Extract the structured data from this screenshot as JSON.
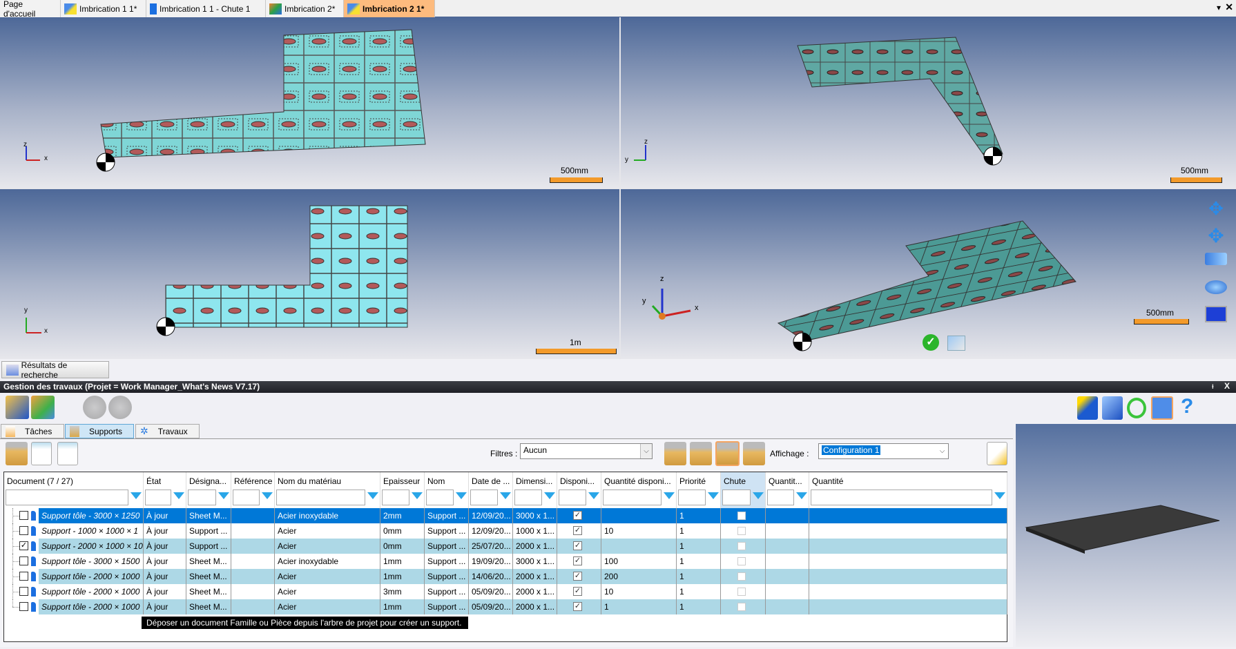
{
  "doc_tabs": [
    {
      "label": "Page d'accueil",
      "icon": "home",
      "active": false
    },
    {
      "label": "Imbrication 1 1*",
      "icon": "nesting-icon",
      "active": false
    },
    {
      "label": "Imbrication 1 1 - Chute 1",
      "icon": "sheet-icon",
      "active": false
    },
    {
      "label": "Imbrication 2*",
      "icon": "part-icon",
      "active": false
    },
    {
      "label": "Imbrication 2 1*",
      "icon": "nesting-icon",
      "active": true
    }
  ],
  "viewports": {
    "scale_tl": "500mm",
    "scale_tr": "500mm",
    "scale_bl": "1m",
    "scale_br": "500mm",
    "axes": {
      "x": "x",
      "y": "y",
      "z": "z"
    }
  },
  "colors": {
    "accent_tab": "#fdbb7e",
    "selected_row": "#0078d7",
    "alt_row": "#add8e6",
    "sheet_cyan": "#7fd6d6",
    "scale_bar": "#f39a2a"
  },
  "results_button": "Résultats de recherche",
  "panel_title": "Gestion des travaux (Projet = Work Manager_What's News V7.17)",
  "panel_controls": {
    "pin": "ᵻ",
    "close": "X"
  },
  "panel_tabs": [
    {
      "label": "Tâches",
      "active": false
    },
    {
      "label": "Supports",
      "active": true
    },
    {
      "label": "Travaux",
      "active": false
    }
  ],
  "filters": {
    "label": "Filtres :",
    "value": "Aucun"
  },
  "display": {
    "label": "Affichage :",
    "value": "Configuration 1"
  },
  "table": {
    "columns": [
      "Document (7 / 27)",
      "État",
      "Désigna...",
      "Référence",
      "Nom du matériau",
      "Epaisseur",
      "Nom",
      "Date de ...",
      "Dimensi...",
      "Disponi...",
      "Quantité disponi...",
      "Priorité",
      "Chute",
      "Quantit...",
      "Quantité"
    ],
    "rows": [
      {
        "checked": false,
        "cells": [
          "Support tôle - 3000 × 1250",
          "À jour",
          "Sheet M...",
          "",
          "Acier inoxydable",
          "2mm",
          "Support ...",
          "12/09/20...",
          "3000 x 1...",
          "☑",
          "",
          "1",
          "",
          "",
          ""
        ],
        "selected": true
      },
      {
        "checked": false,
        "cells": [
          "Support - 1000 × 1000 × 1",
          "À jour",
          "Support ...",
          "",
          "Acier",
          "0mm",
          "Support ...",
          "12/09/20...",
          "1000 x 1...",
          "☑",
          "10",
          "1",
          "",
          "",
          ""
        ]
      },
      {
        "checked": true,
        "cells": [
          "Support - 2000 × 1000 × 10",
          "À jour",
          "Support ...",
          "",
          "Acier",
          "0mm",
          "Support ...",
          "25/07/20...",
          "2000 x 1...",
          "☑",
          "",
          "1",
          "",
          "",
          ""
        ]
      },
      {
        "checked": false,
        "cells": [
          "Support tôle - 3000 × 1500",
          "À jour",
          "Sheet M...",
          "",
          "Acier inoxydable",
          "1mm",
          "Support ...",
          "19/09/20...",
          "3000 x 1...",
          "☑",
          "100",
          "1",
          "",
          "",
          ""
        ]
      },
      {
        "checked": false,
        "cells": [
          "Support tôle - 2000 × 1000",
          "À jour",
          "Sheet M...",
          "",
          "Acier",
          "1mm",
          "Support ...",
          "14/06/20...",
          "2000 x 1...",
          "☑",
          "200",
          "1",
          "",
          "",
          ""
        ]
      },
      {
        "checked": false,
        "cells": [
          "Support tôle - 2000 × 1000",
          "À jour",
          "Sheet M...",
          "",
          "Acier",
          "3mm",
          "Support ...",
          "05/09/20...",
          "2000 x 1...",
          "☑",
          "10",
          "1",
          "",
          "",
          ""
        ]
      },
      {
        "checked": false,
        "cells": [
          "Support tôle - 2000 × 1000",
          "À jour",
          "Sheet M...",
          "",
          "Acier",
          "1mm",
          "Support ...",
          "05/09/20...",
          "2000 x 1...",
          "☑",
          "1",
          "1",
          "",
          "",
          ""
        ]
      }
    ]
  },
  "tooltip": "Déposer un document Famille ou Pièce depuis l'arbre de projet pour créer un support.",
  "check_mark": "✓",
  "help_icon": "?"
}
